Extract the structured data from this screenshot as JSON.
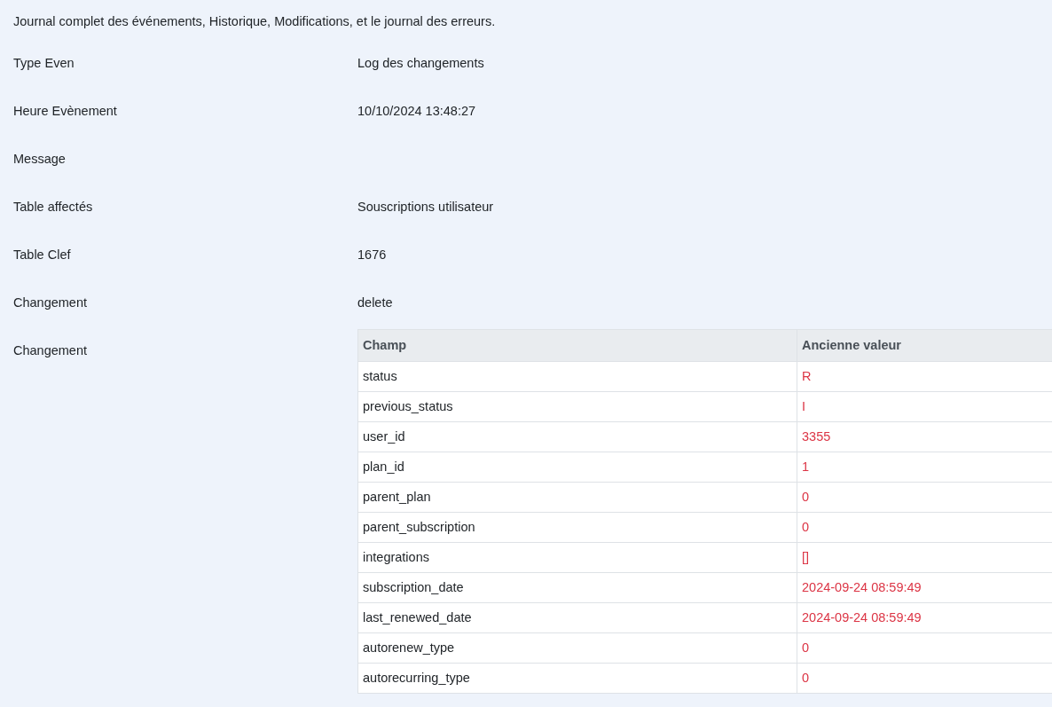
{
  "description": "Journal complet des événements, Historique, Modifications, et le journal des erreurs.",
  "fields": [
    {
      "label": "Type Even",
      "value": "Log des changements"
    },
    {
      "label": "Heure Evènement",
      "value": "10/10/2024 13:48:27"
    },
    {
      "label": "Message"
    },
    {
      "label": "Table affectés",
      "value": "Souscriptions utilisateur"
    },
    {
      "label": "Table Clef",
      "value": "1676"
    },
    {
      "label": "Changement",
      "value": "delete"
    }
  ],
  "changes": {
    "label": "Changement",
    "table": {
      "columns": [
        "Champ",
        "Ancienne valeur"
      ],
      "rows": [
        [
          "status",
          "R"
        ],
        [
          "previous_status",
          "I"
        ],
        [
          "user_id",
          "3355"
        ],
        [
          "plan_id",
          "1"
        ],
        [
          "parent_plan",
          "0"
        ],
        [
          "parent_subscription",
          "0"
        ],
        [
          "integrations",
          "[]"
        ],
        [
          "subscription_date",
          "2024-09-24 08:59:49"
        ],
        [
          "last_renewed_date",
          "2024-09-24 08:59:49"
        ],
        [
          "autorenew_type",
          "0"
        ],
        [
          "autorecurring_type",
          "0"
        ]
      ]
    }
  }
}
